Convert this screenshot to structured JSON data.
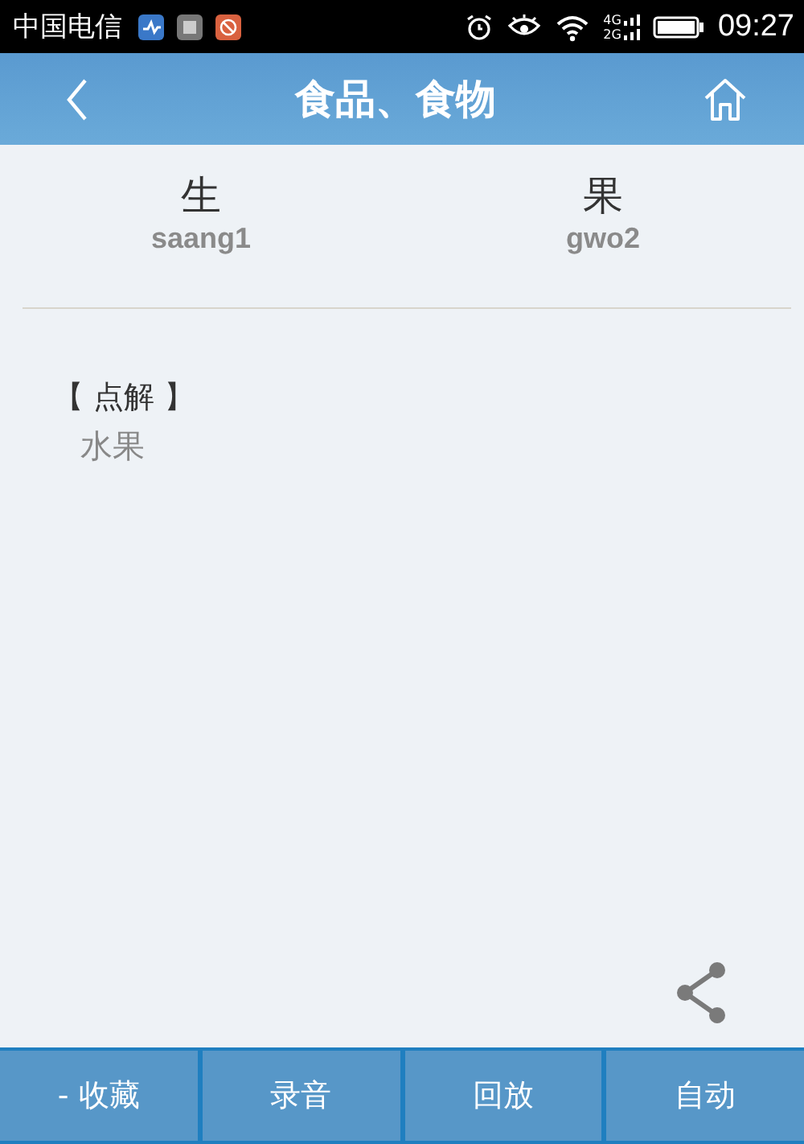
{
  "status_bar": {
    "carrier": "中国电信",
    "network_top": "4G",
    "network_bottom": "2G",
    "time": "09:27"
  },
  "header": {
    "title": "食品、食物"
  },
  "syllables": [
    {
      "character": "生",
      "romanization": "saang1"
    },
    {
      "character": "果",
      "romanization": "gwo2"
    }
  ],
  "explanation": {
    "heading": "【 点解 】",
    "text": "水果"
  },
  "bottom_bar": [
    {
      "label": "- 收藏"
    },
    {
      "label": "录音"
    },
    {
      "label": "回放"
    },
    {
      "label": "自动"
    }
  ]
}
